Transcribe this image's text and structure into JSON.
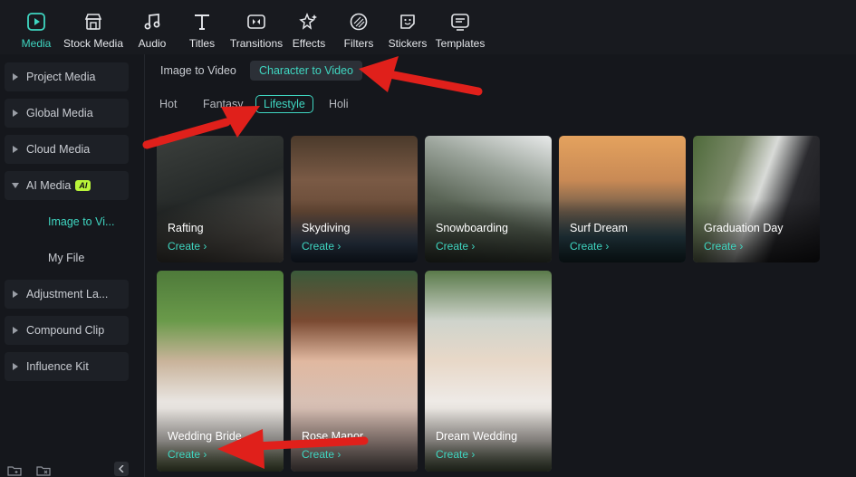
{
  "toolbar": {
    "items": [
      {
        "label": "Media",
        "icon": "media-icon",
        "active": true
      },
      {
        "label": "Stock Media",
        "icon": "stock-media-icon"
      },
      {
        "label": "Audio",
        "icon": "audio-icon"
      },
      {
        "label": "Titles",
        "icon": "titles-icon"
      },
      {
        "label": "Transitions",
        "icon": "transitions-icon"
      },
      {
        "label": "Effects",
        "icon": "effects-icon"
      },
      {
        "label": "Filters",
        "icon": "filters-icon"
      },
      {
        "label": "Stickers",
        "icon": "stickers-icon"
      },
      {
        "label": "Templates",
        "icon": "templates-icon"
      }
    ]
  },
  "sidebar": {
    "items": [
      {
        "label": "Project Media"
      },
      {
        "label": "Global Media"
      },
      {
        "label": "Cloud Media"
      },
      {
        "label": "AI Media",
        "badge": "AI",
        "expanded": true
      },
      {
        "label": "Adjustment La..."
      },
      {
        "label": "Compound Clip"
      },
      {
        "label": "Influence Kit"
      }
    ],
    "sub_items": [
      {
        "label": "Image to Vi...",
        "active": true
      },
      {
        "label": "My File"
      }
    ]
  },
  "main": {
    "tabs": [
      {
        "label": "Image to Video"
      },
      {
        "label": "Character to Video",
        "active": true
      }
    ],
    "categories": [
      {
        "label": "Hot"
      },
      {
        "label": "Fantasy"
      },
      {
        "label": "Lifestyle",
        "active": true
      },
      {
        "label": "Holi"
      }
    ],
    "cards": [
      {
        "title": "Rafting",
        "cta": "Create ›"
      },
      {
        "title": "Skydiving",
        "cta": "Create ›"
      },
      {
        "title": "Snowboarding",
        "cta": "Create ›"
      },
      {
        "title": "Surf Dream",
        "cta": "Create ›"
      },
      {
        "title": "Graduation Day",
        "cta": "Create ›"
      },
      {
        "title": "Wedding Bride",
        "cta": "Create ›"
      },
      {
        "title": "Rose Manor",
        "cta": "Create ›"
      },
      {
        "title": "Dream Wedding",
        "cta": "Create ›"
      }
    ]
  },
  "colors": {
    "accent": "#3fd6c1",
    "annotation": "#e0201b",
    "ai_badge": "#b9f43a"
  }
}
